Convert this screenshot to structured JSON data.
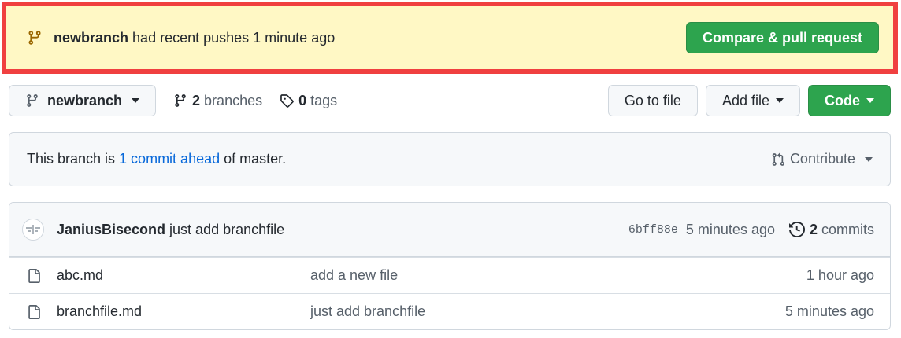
{
  "banner": {
    "branch": "newbranch",
    "message": "had recent pushes 1 minute ago",
    "button_label": "Compare & pull request"
  },
  "toolbar": {
    "branch_selector": "newbranch",
    "branches_count": "2",
    "branches_label": "branches",
    "tags_count": "0",
    "tags_label": "tags",
    "go_to_file": "Go to file",
    "add_file": "Add file",
    "code": "Code"
  },
  "ahead": {
    "prefix": "This branch is",
    "link": "1 commit ahead",
    "suffix": "of master.",
    "contribute": "Contribute"
  },
  "latest_commit": {
    "author": "JaniusBisecond",
    "message": "just add branchfile",
    "sha": "6bff88e",
    "time": "5 minutes ago",
    "commits_count": "2",
    "commits_label": "commits"
  },
  "files": [
    {
      "name": "abc.md",
      "message": "add a new file",
      "age": "1 hour ago"
    },
    {
      "name": "branchfile.md",
      "message": "just add branchfile",
      "age": "5 minutes ago"
    }
  ],
  "colors": {
    "banner_bg": "#fff8c5",
    "banner_border": "#f04040",
    "primary_green": "#2da44e",
    "link_blue": "#0969da"
  },
  "icons": {
    "banner": "git-branch-icon",
    "branch_selector": "git-branch-icon",
    "branches": "git-branch-icon",
    "tags": "tag-icon",
    "contribute": "git-pull-request-icon",
    "commits": "history-icon",
    "file": "file-icon"
  }
}
